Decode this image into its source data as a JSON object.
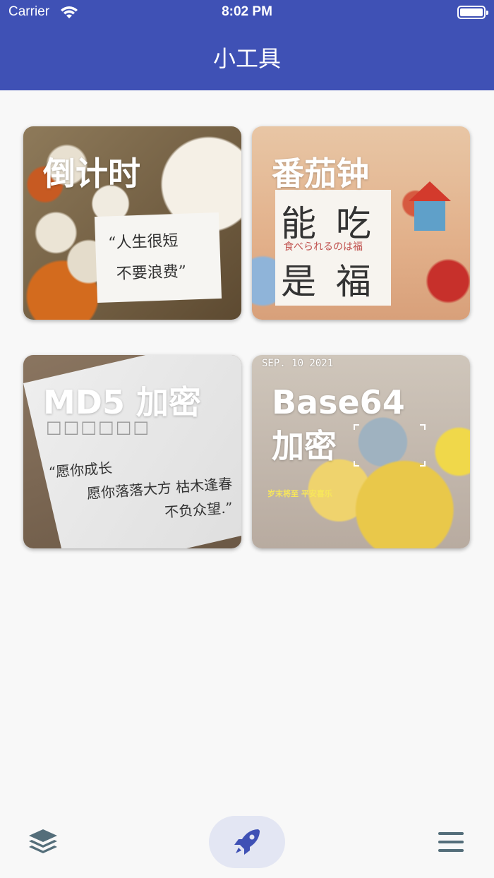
{
  "status_bar": {
    "carrier": "Carrier",
    "time": "8:02 PM"
  },
  "header": {
    "title": "小工具",
    "color": "#3f51b5"
  },
  "tools": [
    {
      "label": "倒计时",
      "photo_text": [
        "“人生很短",
        "不要浪费”"
      ]
    },
    {
      "label": "番茄钟",
      "photo_text": [
        "能 吃",
        "食べられるのは福",
        "是 福"
      ]
    },
    {
      "label": "MD5 加密",
      "photo_text": [
        "“愿你成长",
        "愿你落落大方 枯木逢春",
        "不负众望.”"
      ]
    },
    {
      "label_line1": "Base64",
      "label_line2": "加密",
      "photo_text": [
        "SEP. 10 2021",
        "岁末将至 平安喜乐"
      ]
    }
  ],
  "tab_bar": {
    "items": [
      {
        "icon": "layers-icon",
        "active": false
      },
      {
        "icon": "rocket-icon",
        "active": true
      },
      {
        "icon": "menu-icon",
        "active": false
      }
    ],
    "active_color": "#3f51b5",
    "inactive_color": "#546e7a"
  }
}
